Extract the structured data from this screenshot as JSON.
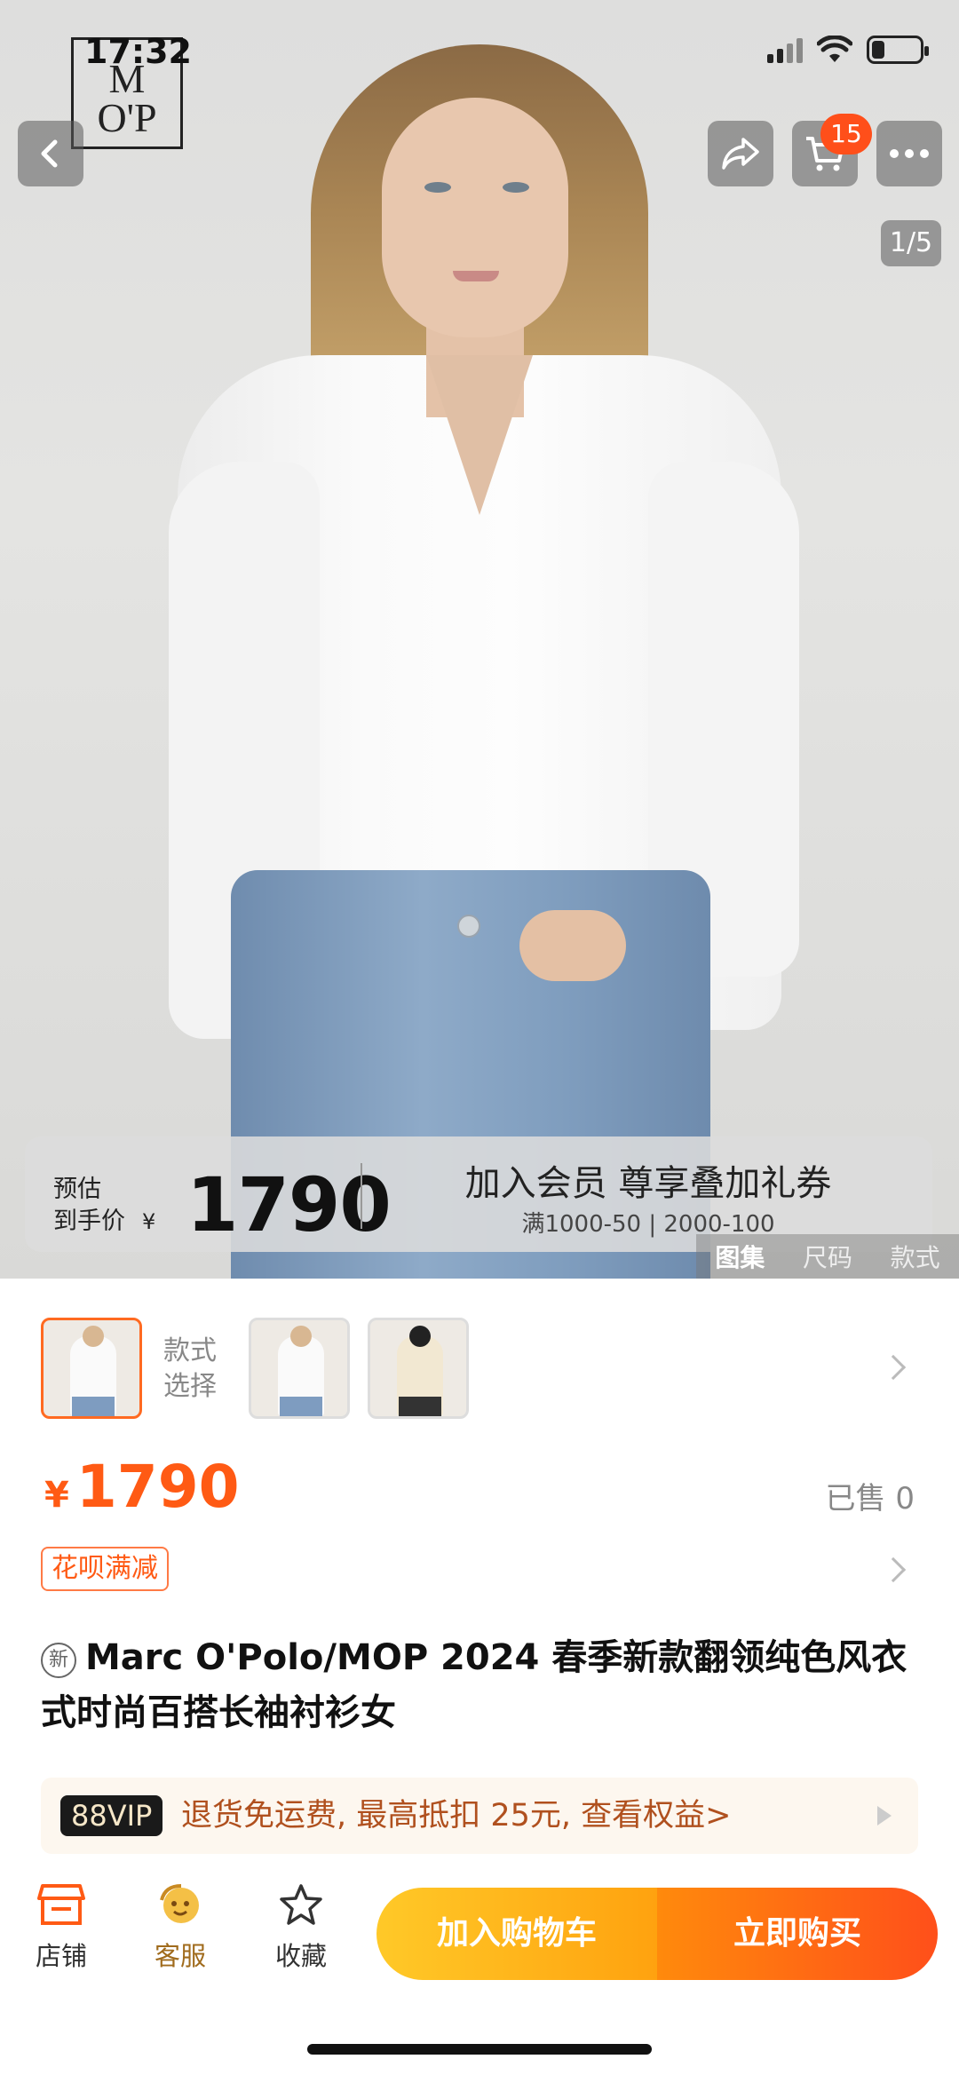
{
  "status_bar": {
    "time": "17:32",
    "battery_level": 0.25
  },
  "brand_logo": {
    "text": "M O'P"
  },
  "top_bar": {
    "back_icon": "chevron-left-icon",
    "share_icon": "share-arrow-icon",
    "cart_icon": "shopping-cart-icon",
    "cart_badge": "15",
    "more_icon": "more-dots-icon"
  },
  "gallery": {
    "counter": "1/5",
    "tabs": [
      "图集",
      "尺码",
      "款式"
    ],
    "active_tab": "图集"
  },
  "promo_banner": {
    "estimate_label_line1": "预估",
    "estimate_label_line2": "到手价",
    "currency": "¥",
    "estimate_price": "1790",
    "headline": "加入会员 尊享叠加礼券",
    "subline": "满1000-50 | 2000-100"
  },
  "variants": {
    "label_line1": "款式",
    "label_line2": "选择",
    "count": 3
  },
  "price": {
    "currency": "¥",
    "value": "1790",
    "sold": "已售 0"
  },
  "tags": {
    "huabei": "花呗满减"
  },
  "product": {
    "new_badge": "新",
    "title": "Marc O'Polo/MOP 2024 春季新款翻领纯色风衣式时尚百搭长袖衬衫女"
  },
  "vip": {
    "badge": "88VIP",
    "text": "退货免运费, 最高抵扣 25元, 查看权益>"
  },
  "bottom_bar": {
    "shop_label": "店铺",
    "service_label": "客服",
    "favorite_label": "收藏",
    "add_to_cart": "加入购物车",
    "buy_now": "立即购买"
  },
  "colors": {
    "accent": "#ff5a14",
    "cart_button": "#ffb11a",
    "buy_button": "#ff5a14",
    "vip_text": "#b0501e"
  }
}
